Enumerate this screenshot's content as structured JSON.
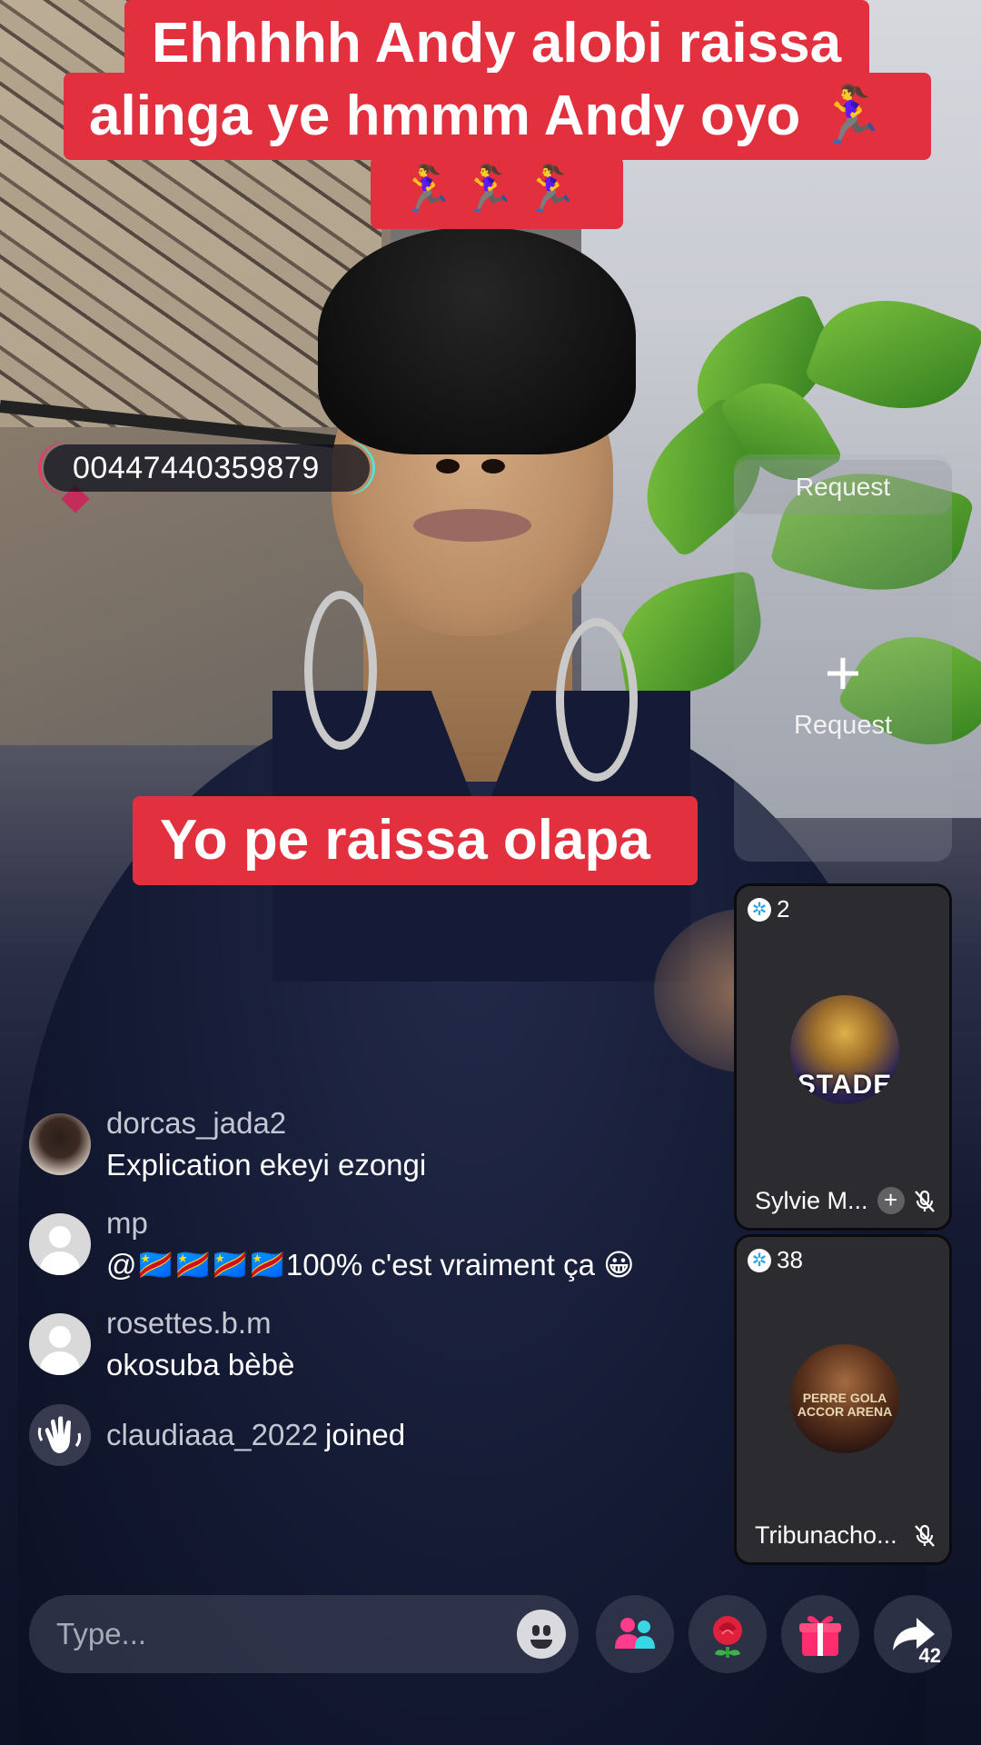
{
  "captions": {
    "top_line1": "Ehhhhh Andy alobi raissa",
    "top_line2": "alinga ye hmmm Andy oyo 🏃‍♀️",
    "top_line3": "🏃‍♀️🏃‍♀️🏃‍♀️",
    "middle": "Yo pe raissa olapa"
  },
  "overlay_bubble": {
    "text": "00447440359879"
  },
  "requests": {
    "top_label": "Request",
    "slot_label": "Request",
    "plus_icon": "plus-icon"
  },
  "guests": [
    {
      "count": "2",
      "name": "Sylvie M...",
      "avatar_text": "STADE",
      "icon": "mic-muted-icon",
      "has_add": true
    },
    {
      "count": "38",
      "name": "Tribunacho...",
      "avatar_text": "PERRE GOLA ACCOR ARENA",
      "icon": "mic-muted-icon",
      "has_add": false
    }
  ],
  "comments": [
    {
      "user": "dorcas_jada2",
      "text": "Explication ekeyi ezongi"
    },
    {
      "user": "mp",
      "text": "@🇨🇩🇨🇩🇨🇩🇨🇩100% c'est vraiment ça 😀"
    },
    {
      "user": "rosettes.b.m",
      "text": "okosuba bèbè"
    }
  ],
  "joined": {
    "user": "claudiaaa_2022",
    "suffix": "joined"
  },
  "bottom_bar": {
    "placeholder": "Type...",
    "share_count": "42",
    "icons": [
      "emoji-icon",
      "multi-guest-icon",
      "rose-gift-icon",
      "gift-box-icon",
      "share-icon"
    ]
  },
  "colors": {
    "caption_bg": "#e2303f",
    "accent_pink": "#e53a6b",
    "accent_teal": "#57e2d4",
    "gem_blue": "#26a7e8"
  }
}
